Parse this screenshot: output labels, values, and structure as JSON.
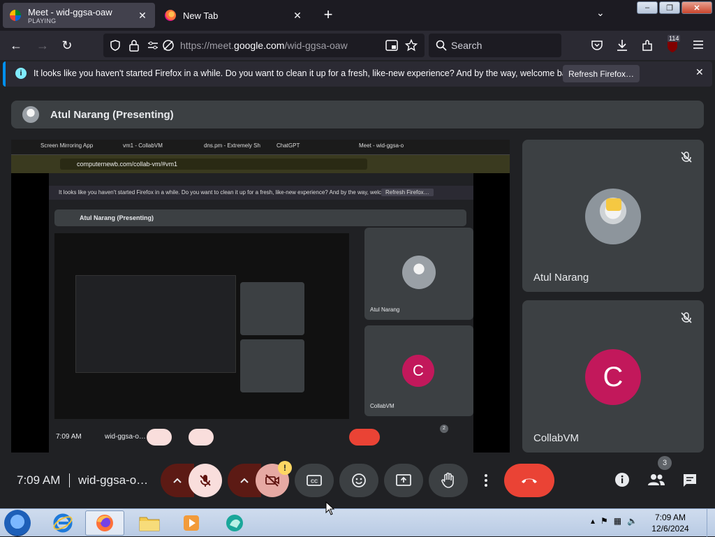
{
  "browser": {
    "tabs": [
      {
        "title": "Meet - wid-ggsa-oaw",
        "subtitle": "PLAYING",
        "close": "✕"
      },
      {
        "title": "New Tab",
        "close": "✕"
      }
    ],
    "new_tab": "+",
    "tab_list": "⌄",
    "window_controls": {
      "minimize": "–",
      "maximize": "❐",
      "close": "✕"
    },
    "nav": {
      "back": "←",
      "forward": "→",
      "reload": "↻",
      "url_prefix": "https://meet.",
      "url_domain": "google.com",
      "url_suffix": "/wid-ggsa-oaw",
      "search_placeholder": "Search",
      "extensions_badge": "114"
    },
    "notification": {
      "text": "It looks like you haven't started Firefox in a while. Do you want to clean it up for a fresh, like-new experience? And by the way, welcome back!",
      "button": "Refresh Firefox…",
      "close": "✕"
    }
  },
  "meet": {
    "presenter_label": "Atul Narang (Presenting)",
    "captured": {
      "tabs": [
        "Screen Mirroring App",
        "vm1 - CollabVM",
        "dns.pm - Extremely Sh",
        "ChatGPT",
        "Meet - wid-ggsa-o"
      ],
      "url": "computernewb.com/collab-vm/#vm1",
      "inner_notification": "It looks like you haven't started Firefox in a while. Do you want to clean it up for a fresh, like-new experience? And by the way, welcome back!",
      "inner_refresh": "Refresh Firefox…",
      "inner_presenter": "Atul Narang (Presenting)",
      "tile1_name": "Atul Narang",
      "tile2_name": "CollabVM",
      "tile2_initial": "C",
      "inner_time": "7:09 AM",
      "inner_code": "wid-ggsa-o…",
      "inner_people_count": "2"
    },
    "participants": [
      {
        "name": "Atul Narang",
        "muted": true
      },
      {
        "name": "CollabVM",
        "initial": "C",
        "muted": true
      }
    ],
    "controls": {
      "time": "7:09 AM",
      "meeting_code": "wid-ggsa-o…",
      "warning_badge": "!",
      "people_count": "3"
    }
  },
  "taskbar": {
    "time": "7:09 AM",
    "date": "12/6/2024"
  }
}
